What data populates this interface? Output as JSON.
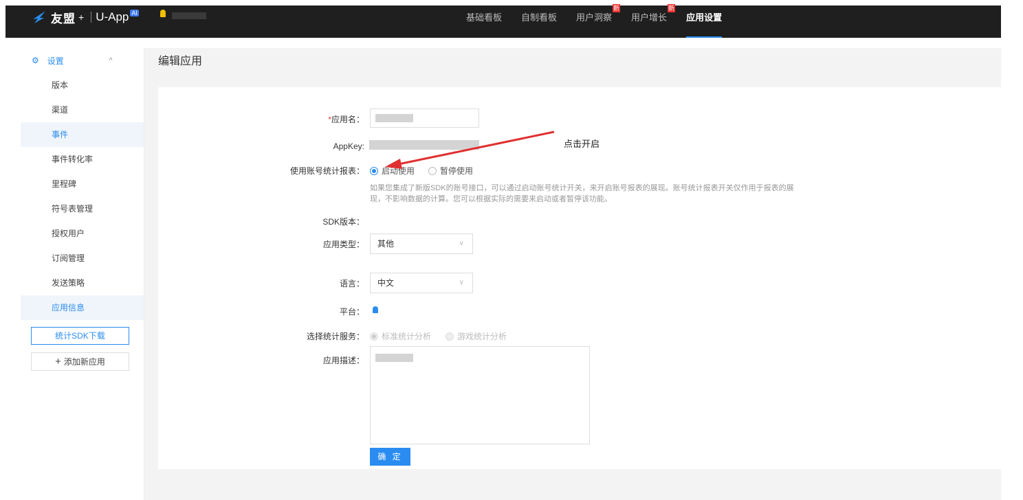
{
  "header": {
    "brand": "友盟",
    "plus": "+",
    "product": "U-App",
    "ai_badge": "AI",
    "nav": [
      {
        "label": "基础看板",
        "badge": ""
      },
      {
        "label": "自制看板",
        "badge": ""
      },
      {
        "label": "用户洞察",
        "badge": "新"
      },
      {
        "label": "用户增长",
        "badge": "新"
      },
      {
        "label": "应用设置",
        "badge": ""
      }
    ]
  },
  "sidebar": {
    "section": "设置",
    "items": [
      "版本",
      "渠道",
      "事件",
      "事件转化率",
      "里程碑",
      "符号表管理",
      "授权用户",
      "订阅管理",
      "发送策略",
      "应用信息"
    ],
    "sdk_button": "统计SDK下载",
    "add_button": "添加新应用",
    "add_icon": "+"
  },
  "main": {
    "title": "编辑应用",
    "form": {
      "app_name_label": "应用名：",
      "required_mark": "*",
      "appkey_label": "AppKey:",
      "account_stats_label": "使用账号统计报表：",
      "radio_enable": "启动使用",
      "radio_pause": "暂停使用",
      "hint": "如果您集成了新版SDK的账号接口，可以通过启动账号统计开关，来开启账号报表的展现。账号统计报表开关仅作用于报表的展现，不影响数据的计算。您可以根据实际的需要来启动或者暂停该功能。",
      "sdk_version_label": "SDK版本：",
      "app_type_label": "应用类型：",
      "app_type_value": "其他",
      "language_label": "语言：",
      "language_value": "中文",
      "platform_label": "平台：",
      "service_label": "选择统计服务：",
      "service_standard": "标准统计分析",
      "service_game": "游戏统计分析",
      "desc_label": "应用描述：",
      "submit": "确 定"
    },
    "annotation": "点击开启"
  },
  "colors": {
    "accent": "#2a8cf0",
    "topbar": "#1f1f1f",
    "badge": "#e33333"
  }
}
